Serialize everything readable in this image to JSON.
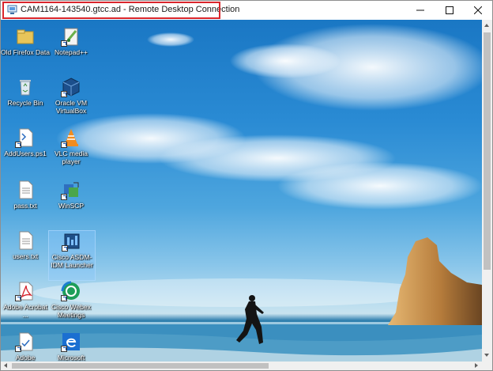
{
  "window": {
    "title": "CAM1164-143540.gtcc.ad - Remote Desktop Connection",
    "minimize_icon": "minimize-icon",
    "maximize_icon": "maximize-icon",
    "close_icon": "close-icon"
  },
  "desktop": {
    "icons": [
      {
        "label": "Old Firefox Data",
        "icon": "folder-icon"
      },
      {
        "label": "Notepad++",
        "icon": "notepad-plus-plus-icon"
      },
      {
        "label": "Recycle Bin",
        "icon": "recycle-bin-icon"
      },
      {
        "label": "Oracle VM VirtualBox",
        "icon": "virtualbox-icon"
      },
      {
        "label": "AddUsers.ps1",
        "icon": "script-file-icon"
      },
      {
        "label": "VLC media player",
        "icon": "vlc-icon"
      },
      {
        "label": "pass.txt",
        "icon": "text-file-icon"
      },
      {
        "label": "WinSCP",
        "icon": "winscp-icon"
      },
      {
        "label": "users.txt",
        "icon": "text-file-icon"
      },
      {
        "label": "Cisco ASDM-IDM Launcher",
        "icon": "cisco-asdm-icon"
      },
      {
        "label": "Adobe Acrobat ...",
        "icon": "adobe-acrobat-icon"
      },
      {
        "label": "Cisco Webex Meetings",
        "icon": "webex-icon"
      },
      {
        "label": "Adobe",
        "icon": "adobe-icon"
      },
      {
        "label": "Microsoft",
        "icon": "edge-icon"
      }
    ]
  },
  "colors": {
    "highlight": "#d9262c",
    "sky": "#2a8bd4"
  }
}
